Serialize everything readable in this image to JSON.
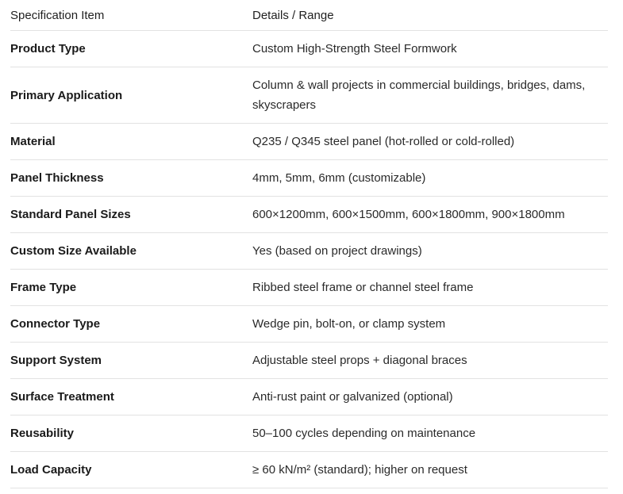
{
  "header": {
    "item": "Specification Item",
    "details": "Details / Range"
  },
  "rows": [
    {
      "item": "Product Type",
      "details": "Custom High-Strength Steel Formwork"
    },
    {
      "item": "Primary Application",
      "details": "Column & wall projects in commercial buildings, bridges, dams, skyscrapers"
    },
    {
      "item": "Material",
      "details": "Q235 / Q345 steel panel (hot-rolled or cold-rolled)"
    },
    {
      "item": "Panel Thickness",
      "details": "4mm, 5mm, 6mm (customizable)"
    },
    {
      "item": "Standard Panel Sizes",
      "details": "600×1200mm, 600×1500mm, 600×1800mm, 900×1800mm"
    },
    {
      "item": "Custom Size Available",
      "details": "Yes (based on project drawings)"
    },
    {
      "item": "Frame Type",
      "details": "Ribbed steel frame or channel steel frame"
    },
    {
      "item": "Connector Type",
      "details": "Wedge pin, bolt-on, or clamp system"
    },
    {
      "item": "Support System",
      "details": "Adjustable steel props + diagonal braces"
    },
    {
      "item": "Surface Treatment",
      "details": "Anti-rust paint or galvanized (optional)"
    },
    {
      "item": "Reusability",
      "details": "50–100 cycles depending on maintenance"
    },
    {
      "item": "Load Capacity",
      "details": "≥ 60 kN/m² (standard); higher on request"
    }
  ]
}
